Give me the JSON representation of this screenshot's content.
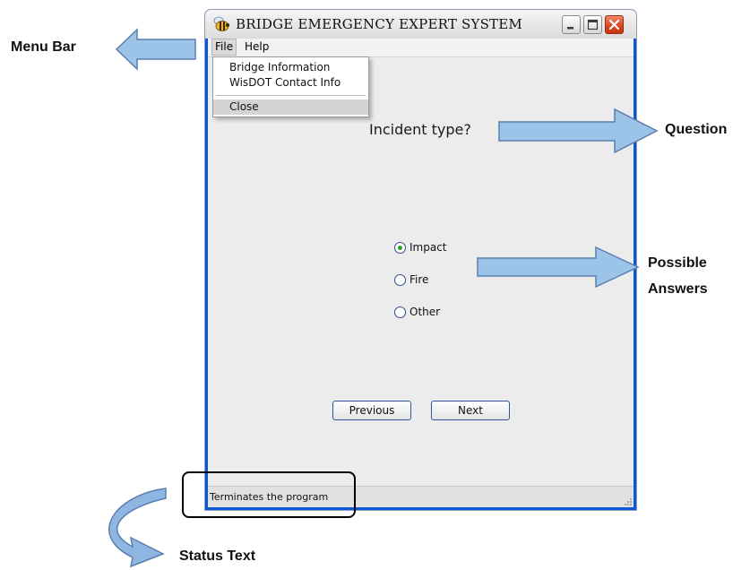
{
  "window": {
    "title": "BRIDGE EMERGENCY EXPERT SYSTEM",
    "app_icon": "bee-icon",
    "controls": [
      "minimize-icon",
      "maximize-icon",
      "close-icon"
    ]
  },
  "menubar": {
    "file_label": "File",
    "help_label": "Help"
  },
  "file_menu": {
    "items": [
      "Bridge Information",
      "WisDOT Contact Info"
    ],
    "close_label": "Close"
  },
  "question": {
    "text": "Incident type?"
  },
  "answers": {
    "options": [
      "Impact",
      "Fire",
      "Other"
    ],
    "selected": "Impact"
  },
  "buttons": {
    "previous_label": "Previous",
    "next_label": "Next"
  },
  "statusbar": {
    "text": "Terminates the program"
  },
  "annotations": {
    "menu_bar": "Menu Bar",
    "question": "Question",
    "possible_answers_line1": "Possible",
    "possible_answers_line2": "Answers",
    "status_text": "Status Text",
    "arrow_color": "#9cc3e8",
    "arrow_stroke": "#5b7fb0"
  }
}
